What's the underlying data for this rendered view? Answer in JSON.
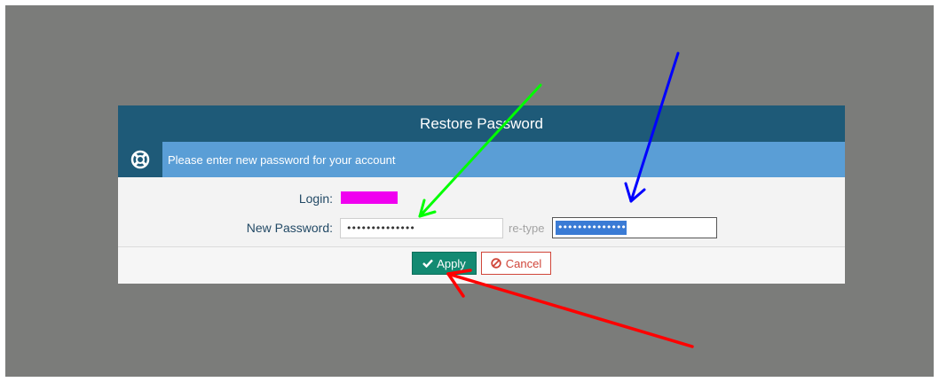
{
  "dialog": {
    "title": "Restore Password",
    "info_text": "Please enter new password for your account",
    "info_icon": "lifebuoy-icon",
    "fields": {
      "login_label": "Login:",
      "new_password_label": "New Password:",
      "new_password_value": "••••••••••••••",
      "retype_label": "re-type",
      "retype_value": "••••••••••••••"
    },
    "buttons": {
      "apply_label": "Apply",
      "apply_icon": "checkmark-icon",
      "cancel_label": "Cancel",
      "cancel_icon": "cancel-circle-icon"
    }
  },
  "colors": {
    "title_bar": "#1e5a78",
    "info_bar": "#5a9ed6",
    "apply": "#138a72",
    "cancel": "#d0463a",
    "login_redaction": "#f000f0",
    "arrow_green": "#00ff00",
    "arrow_blue": "#0000ff",
    "arrow_red": "#ff0000"
  }
}
